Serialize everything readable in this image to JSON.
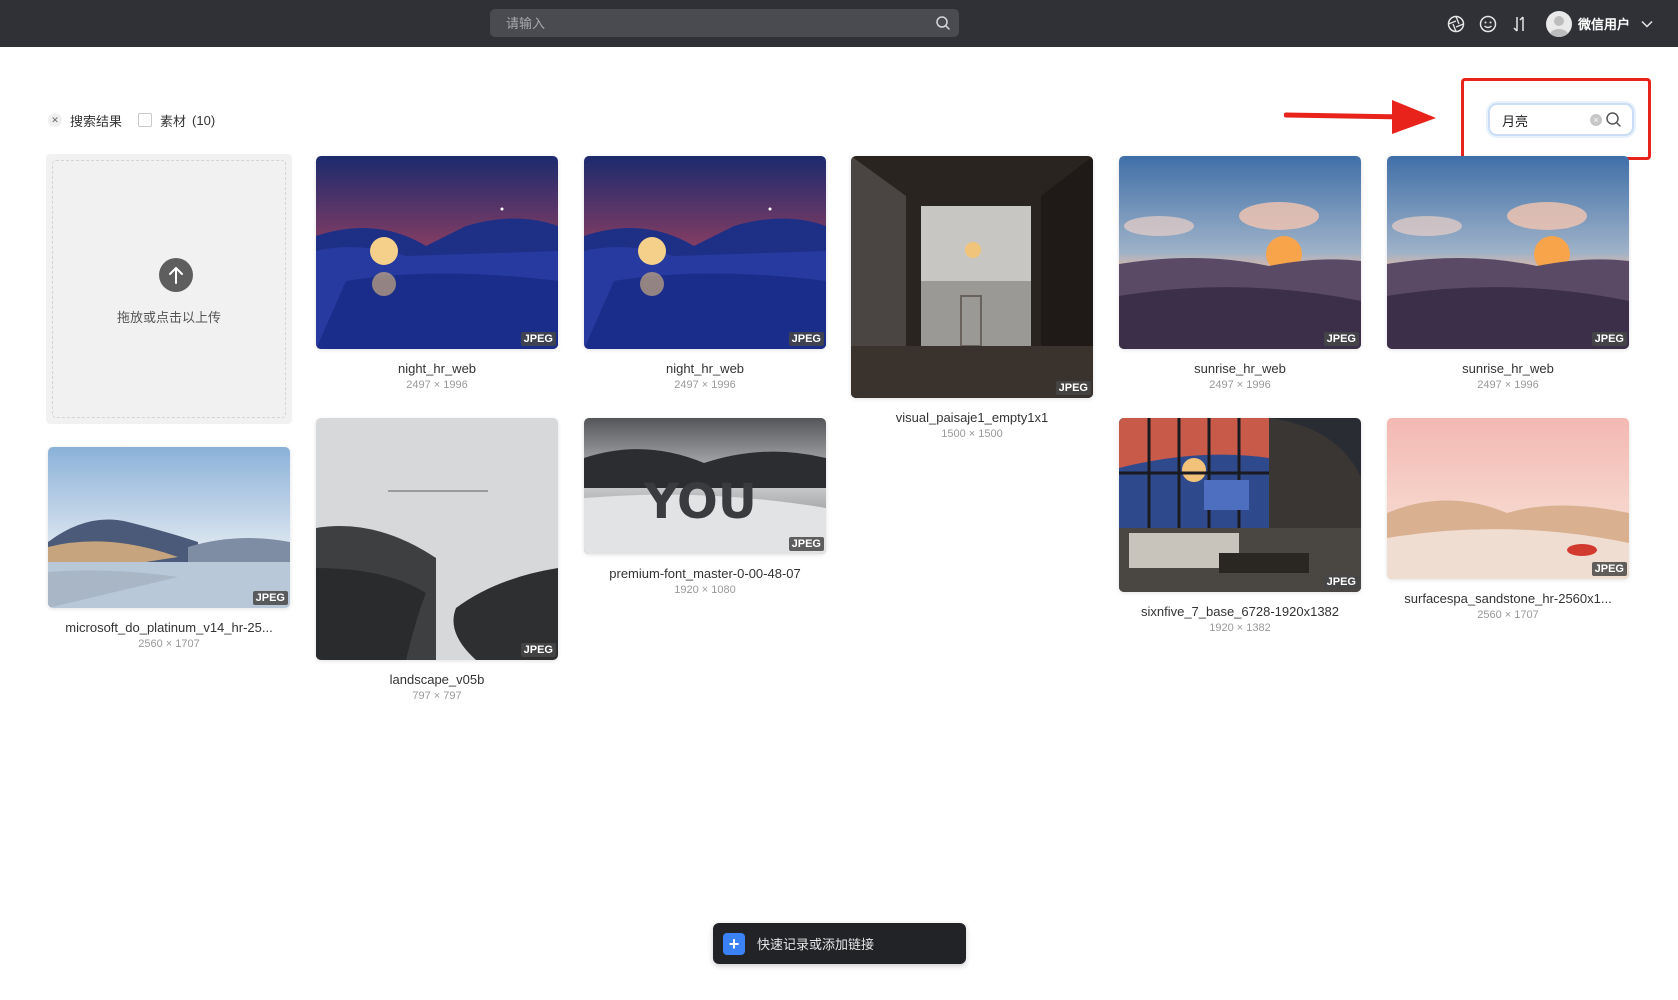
{
  "topbar": {
    "search_placeholder": "请输入",
    "icons": [
      "aperture-icon",
      "smile-icon",
      "sort-icon"
    ],
    "user_name": "微信用户"
  },
  "filters": {
    "search_results_label": "搜索结果",
    "material_label": "素材",
    "material_count": "(10)"
  },
  "side_search": {
    "value": "月亮"
  },
  "upload": {
    "label": "拖放或点击以上传"
  },
  "items": [
    {
      "name": "night_hr_web",
      "dims": "2497 × 1996",
      "format": "JPEG"
    },
    {
      "name": "night_hr_web",
      "dims": "2497 × 1996",
      "format": "JPEG"
    },
    {
      "name": "visual_paisaje1_empty1x1",
      "dims": "1500 × 1500",
      "format": "JPEG"
    },
    {
      "name": "sunrise_hr_web",
      "dims": "2497 × 1996",
      "format": "JPEG"
    },
    {
      "name": "sunrise_hr_web",
      "dims": "2497 × 1996",
      "format": "JPEG"
    },
    {
      "name": "microsoft_do_platinum_v14_hr-25...",
      "dims": "2560 × 1707",
      "format": "JPEG"
    },
    {
      "name": "landscape_v05b",
      "dims": "797 × 797",
      "format": "JPEG"
    },
    {
      "name": "premium-font_master-0-00-48-07",
      "dims": "1920 × 1080",
      "format": "JPEG"
    },
    {
      "name": "sixnfive_7_base_6728-1920x1382",
      "dims": "1920 × 1382",
      "format": "JPEG"
    },
    {
      "name": "surfacespa_sandstone_hr-2560x1...",
      "dims": "2560 × 1707",
      "format": "JPEG"
    }
  ],
  "quickbar": {
    "label": "快速记录或添加链接"
  },
  "colors": {
    "topbar_bg": "#2f3136",
    "annotation_red": "#e8231b",
    "quick_plus_blue": "#3b82f6"
  }
}
